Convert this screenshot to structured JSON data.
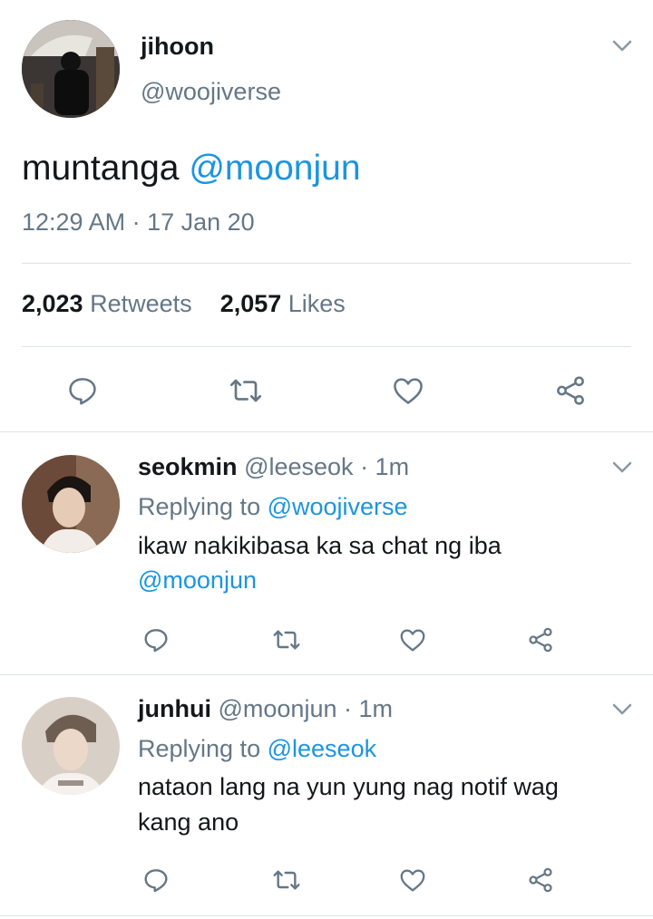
{
  "main_tweet": {
    "display_name": "jihoon",
    "handle": "@woojiverse",
    "text": "muntanga",
    "mention": "@moonjun",
    "timestamp": "12:29 AM · 17 Jan 20",
    "retweet_count": "2,023",
    "retweet_label": "Retweets",
    "like_count": "2,057",
    "like_label": "Likes"
  },
  "replies": [
    {
      "display_name": "seokmin",
      "handle": "@leeseok",
      "time": "· 1m",
      "replying_prefix": "Replying to",
      "replying_to": "@woojiverse",
      "text_line1": "ikaw nakikibasa ka sa chat ng iba",
      "text_line2": "@moonjun"
    },
    {
      "display_name": "junhui",
      "handle": "@moonjun",
      "time": "· 1m",
      "replying_prefix": "Replying to",
      "replying_to": "@leeseok",
      "text_line1": "nataon lang na yun yung nag notif wag",
      "text_line2": "kang ano"
    }
  ],
  "colors": {
    "link": "#1b95e0",
    "secondary_text": "#657786",
    "divider": "#dfe3e7",
    "icon": "#657786"
  },
  "icons": [
    "reply-icon",
    "retweet-icon",
    "like-icon",
    "share-icon",
    "chevron-down-icon"
  ]
}
